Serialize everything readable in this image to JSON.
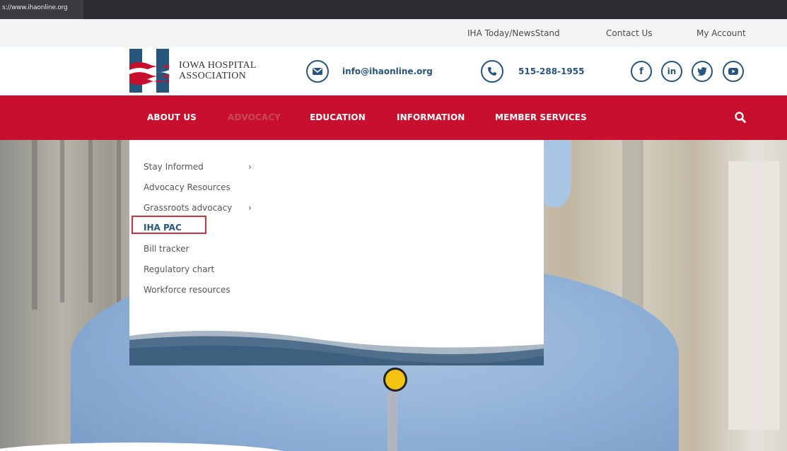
{
  "browser": {
    "url": "s://www.ihaonline.org"
  },
  "utility_nav": {
    "items": [
      "IHA Today/NewsStand",
      "Contact Us",
      "My Account"
    ]
  },
  "logo": {
    "line1": "IOWA HOSPITAL",
    "line2": "ASSOCIATION"
  },
  "contact": {
    "email": "info@ihaonline.org",
    "phone": "515-288-1955",
    "email_icon": "envelope-icon",
    "phone_icon": "phone-icon"
  },
  "social": {
    "facebook": "f",
    "linkedin": "in"
  },
  "nav": {
    "items": [
      "ABOUT US",
      "ADVOCACY",
      "EDUCATION",
      "INFORMATION",
      "MEMBER SERVICES"
    ],
    "active": "ADVOCACY"
  },
  "dropdown": {
    "items": [
      {
        "label": "Stay Informed",
        "chevron": "›"
      },
      {
        "label": "Advocacy Resources",
        "chevron": ""
      },
      {
        "label": "Grassroots advocacy",
        "chevron": "›"
      },
      {
        "label": "IHA PAC",
        "chevron": ""
      },
      {
        "label": "Bill tracker",
        "chevron": ""
      },
      {
        "label": "Regulatory chart",
        "chevron": ""
      },
      {
        "label": "Workforce resources",
        "chevron": ""
      }
    ],
    "highlighted": "IHA PAC"
  },
  "colors": {
    "brand_red": "#c8102e",
    "brand_blue": "#27557c",
    "highlight_border": "#d0313f"
  }
}
